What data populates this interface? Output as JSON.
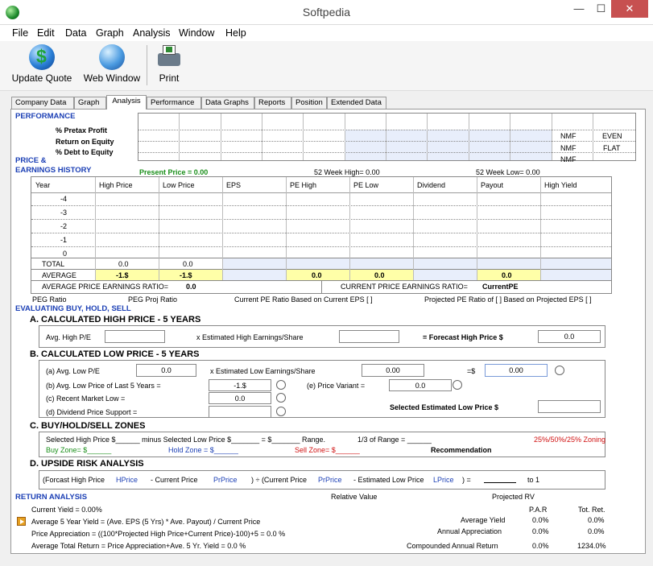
{
  "window": {
    "title": "Softpedia",
    "minimize": "—",
    "maximize": "☐",
    "close": "✕"
  },
  "menu": [
    "File",
    "Edit",
    "Data",
    "Graph",
    "Analysis",
    "Window",
    "Help"
  ],
  "toolbar": {
    "update_quote": "Update Quote",
    "web_window": "Web Window",
    "print": "Print"
  },
  "tabs": [
    "Company Data",
    "Graph",
    "Analysis",
    "Performance",
    "Data Graphs",
    "Reports",
    "Position",
    "Extended Data"
  ],
  "active_tab": "Analysis",
  "performance": {
    "heading": "PERFORMANCE",
    "rows": [
      "% Pretax Profit",
      "Return on Equity",
      "% Debt to Equity"
    ],
    "nmf": [
      "NMF",
      "NMF",
      "NMF"
    ],
    "trend": [
      "EVEN",
      "FLAT"
    ]
  },
  "history": {
    "heading1": "PRICE &",
    "heading2": "EARNINGS HISTORY",
    "present_price": "Present Price = 0.00",
    "week52_high": "52 Week High= 0.00",
    "week52_low": "52 Week Low= 0.00",
    "columns": [
      "Year",
      "High Price",
      "Low Price",
      "EPS",
      "PE High",
      "PE Low",
      "Dividend",
      "Payout",
      "High Yield"
    ],
    "years": [
      "-4",
      "-3",
      "-2",
      "-1",
      "0"
    ],
    "total_label": "TOTAL",
    "total_high": "0.0",
    "total_low": "0.0",
    "average_label": "AVERAGE",
    "avg_high": "-1.$",
    "avg_low": "-1.$",
    "avg_pe_high": "0.0",
    "avg_pe_low": "0.0",
    "avg_payout": "0.0",
    "avg_pe_ratio_label": "AVERAGE PRICE EARNINGS RATIO=",
    "avg_pe_ratio_value": "0.0",
    "cur_pe_ratio_label": "CURRENT PRICE EARNINGS RATIO=",
    "cur_pe_ratio_value": "CurrentPE",
    "peg_ratio": "PEG Ratio",
    "peg_proj": "PEG Proj Ratio",
    "cur_pe_note": "Current PE Ratio Based on Current EPS [ ]",
    "proj_pe_note": "Projected PE Ratio of [ ] Based on Projected EPS [ ]"
  },
  "evaluating": "EVALUATING BUY, HOLD, SELL",
  "sectionA": {
    "title": "A.  CALCULATED HIGH PRICE - 5 YEARS",
    "avg_high_pe": "Avg. High P/E",
    "x_est": "x  Estimated High Earnings/Share",
    "forecast": "= Forecast High Price  $",
    "forecast_value": "0.0"
  },
  "sectionB": {
    "title": "B. CALCULATED LOW PRICE - 5 YEARS",
    "a_label": "(a) Avg. Low P/E",
    "a_value": "0.0",
    "x_est_low": "x Estimated Low Earnings/Share",
    "est_low_value": "0.00",
    "eq": "=$",
    "eq_value": "0.00",
    "b_label": "(b) Avg. Low Price of Last 5 Years =",
    "b_value": "-1.$",
    "e_label": "(e) Price Variant =",
    "e_value": "0.0",
    "c_label": "(c) Recent Market Low =",
    "c_value": "0.0",
    "d_label": "(d) Dividend Price Support =",
    "selected_low": "Selected Estimated Low Price   $"
  },
  "sectionC": {
    "title": "C. BUY/HOLD/SELL ZONES",
    "line1a": "Selected High Price $______  minus Selected Low Price $_______ = $_______  Range.",
    "line1b": "1/3 of Range = ______",
    "zoning": "25%/50%/25% Zoning",
    "buy": "Buy Zone= $______",
    "hold": "Hold Zone = $______",
    "sell": "Sell Zone= $______",
    "recommendation": "Recommendation"
  },
  "sectionD": {
    "title": "D. UPSIDE RISK ANALYSIS",
    "forcast": "(Forcast High Price",
    "hprice": "HPrice",
    "minus_cur": "-  Current Price",
    "prprice1": "PrPrice",
    "div_cur": ") ÷ (Current Price",
    "prprice2": "PrPrice",
    "minus_est": "- Estimated Low Price",
    "lprice": "LPrice",
    "close_eq": ") =",
    "to1": "to 1"
  },
  "return": {
    "heading": "RETURN ANALYSIS",
    "relative_value": "Relative Value",
    "projected_rv": "Projected RV",
    "par": "P.A.R",
    "tot_ret": "Tot. Ret.",
    "current_yield": "Current Yield = 0.00%",
    "avg5": "Average 5 Year Yield = (Ave. EPS (5 Yrs) * Ave. Payout) / Current Price",
    "price_app": "Price Appreciation = ((100*Projected High Price+Current Price)-100)+5 = 0.0 %",
    "avg_total": "Average Total Return = Price Appreciation+Ave. 5 Yr. Yield = 0.0 %",
    "average_yield": "Average Yield",
    "annual_app": "Annual Appreciation",
    "compounded": "Compounded Annual Return",
    "ay_par": "0.0%",
    "ay_tot": "0.0%",
    "aa_par": "0.0%",
    "aa_tot": "0.0%",
    "car_par": "0.0%",
    "car_tot": "1234.0%"
  }
}
